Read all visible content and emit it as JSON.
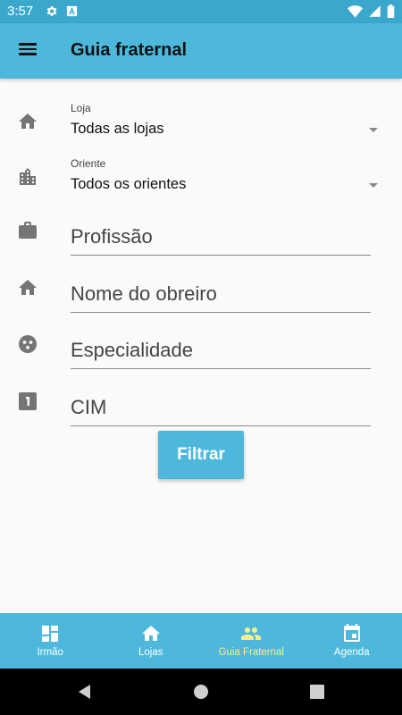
{
  "status_bar": {
    "time": "3:57"
  },
  "app_bar": {
    "title": "Guia fraternal"
  },
  "form": {
    "loja": {
      "label": "Loja",
      "value": "Todas as lojas"
    },
    "oriente": {
      "label": "Oriente",
      "value": "Todos os orientes"
    },
    "profissao": {
      "placeholder": "Profissão"
    },
    "nome_obreiro": {
      "placeholder": "Nome do obreiro"
    },
    "especialidade": {
      "placeholder": "Especialidade"
    },
    "cim": {
      "placeholder": "CIM"
    },
    "filter_button": "Filtrar"
  },
  "bottom_nav": {
    "items": [
      {
        "label": "Irmão",
        "icon": "dashboard-icon",
        "active": false
      },
      {
        "label": "Lojas",
        "icon": "home-icon",
        "active": false
      },
      {
        "label": "Guia Fraternal",
        "icon": "people-icon",
        "active": true
      },
      {
        "label": "Agenda",
        "icon": "calendar-icon",
        "active": false
      }
    ]
  },
  "colors": {
    "primary": "#4db8dc",
    "status_bar": "#3aa8cc",
    "active_nav_label": "#f7f08a",
    "icon_gray": "#757575"
  }
}
